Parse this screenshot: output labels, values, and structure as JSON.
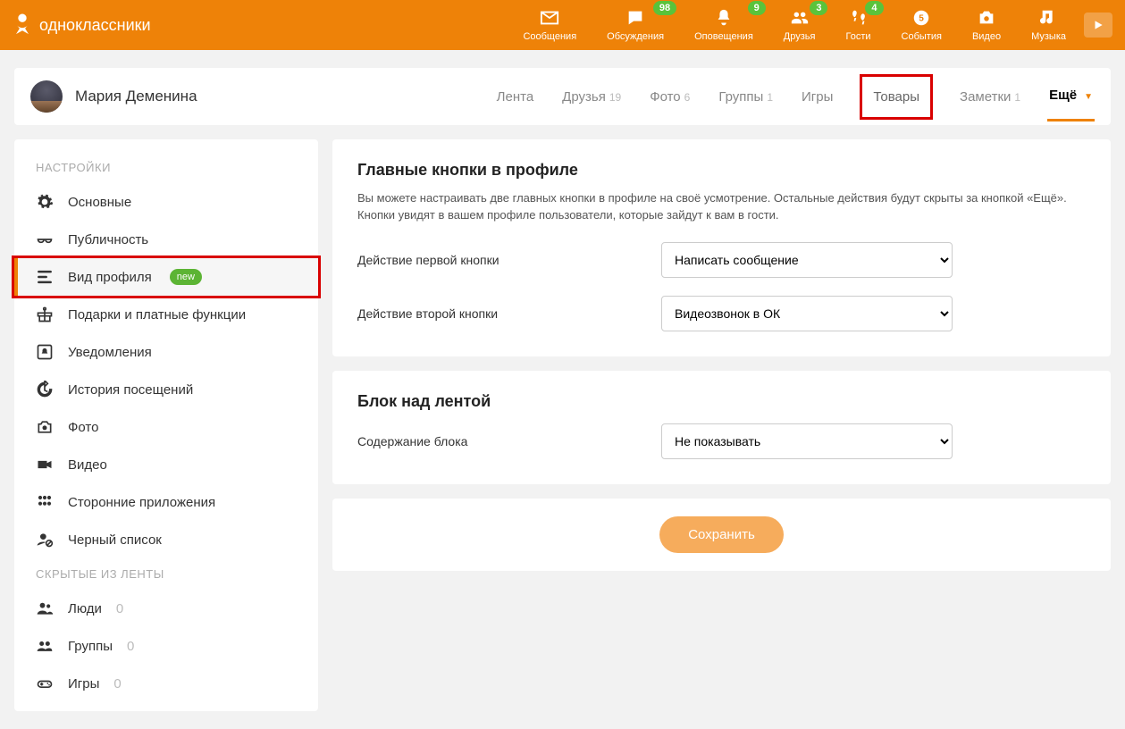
{
  "header": {
    "logo_text": "одноклассники",
    "nav": [
      {
        "key": "messages",
        "label": "Сообщения",
        "badge": null
      },
      {
        "key": "discussions",
        "label": "Обсуждения",
        "badge": "98"
      },
      {
        "key": "notifications",
        "label": "Оповещения",
        "badge": "9"
      },
      {
        "key": "friends",
        "label": "Друзья",
        "badge": "3"
      },
      {
        "key": "guests",
        "label": "Гости",
        "badge": "4"
      },
      {
        "key": "events",
        "label": "События",
        "badge": null
      },
      {
        "key": "video",
        "label": "Видео",
        "badge": null
      },
      {
        "key": "music",
        "label": "Музыка",
        "badge": null
      }
    ]
  },
  "profile": {
    "name": "Мария Деменина",
    "tabs": [
      {
        "key": "feed",
        "label": "Лента"
      },
      {
        "key": "friends",
        "label": "Друзья",
        "count": "19"
      },
      {
        "key": "photo",
        "label": "Фото",
        "count": "6"
      },
      {
        "key": "groups",
        "label": "Группы",
        "count": "1"
      },
      {
        "key": "games",
        "label": "Игры"
      },
      {
        "key": "products",
        "label": "Товары",
        "highlight": true
      },
      {
        "key": "notes",
        "label": "Заметки",
        "count": "1"
      },
      {
        "key": "more",
        "label": "Ещё",
        "more": true
      }
    ]
  },
  "sidebar": {
    "title1": "НАСТРОЙКИ",
    "title2": "СКРЫТЫЕ ИЗ ЛЕНТЫ",
    "items1": [
      {
        "label": "Основные",
        "icon": "gear"
      },
      {
        "label": "Публичность",
        "icon": "glasses"
      },
      {
        "label": "Вид профиля",
        "icon": "layout",
        "active": true,
        "new": "new",
        "highlight": true
      },
      {
        "label": "Подарки и платные функции",
        "icon": "gift"
      },
      {
        "label": "Уведомления",
        "icon": "bell-box"
      },
      {
        "label": "История посещений",
        "icon": "history"
      },
      {
        "label": "Фото",
        "icon": "camera"
      },
      {
        "label": "Видео",
        "icon": "videocam"
      },
      {
        "label": "Сторонние приложения",
        "icon": "apps"
      },
      {
        "label": "Черный список",
        "icon": "blacklist"
      }
    ],
    "items2": [
      {
        "label": "Люди",
        "zero": "0",
        "icon": "people"
      },
      {
        "label": "Группы",
        "zero": "0",
        "icon": "groups"
      },
      {
        "label": "Игры",
        "zero": "0",
        "icon": "gamepad"
      }
    ]
  },
  "main": {
    "section1": {
      "title": "Главные кнопки в профиле",
      "desc": "Вы можете настраивать две главных кнопки в профиле на своё усмотрение. Остальные действия будут скрыты за кнопкой «Ещё». Кнопки увидят в вашем профиле пользователи, которые зайдут к вам в гости.",
      "row1_label": "Действие первой кнопки",
      "row1_value": "Написать сообщение",
      "row2_label": "Действие второй кнопки",
      "row2_value": "Видеозвонок в ОК"
    },
    "section2": {
      "title": "Блок над лентой",
      "row_label": "Содержание блока",
      "row_value": "Не показывать"
    },
    "save": "Сохранить"
  }
}
